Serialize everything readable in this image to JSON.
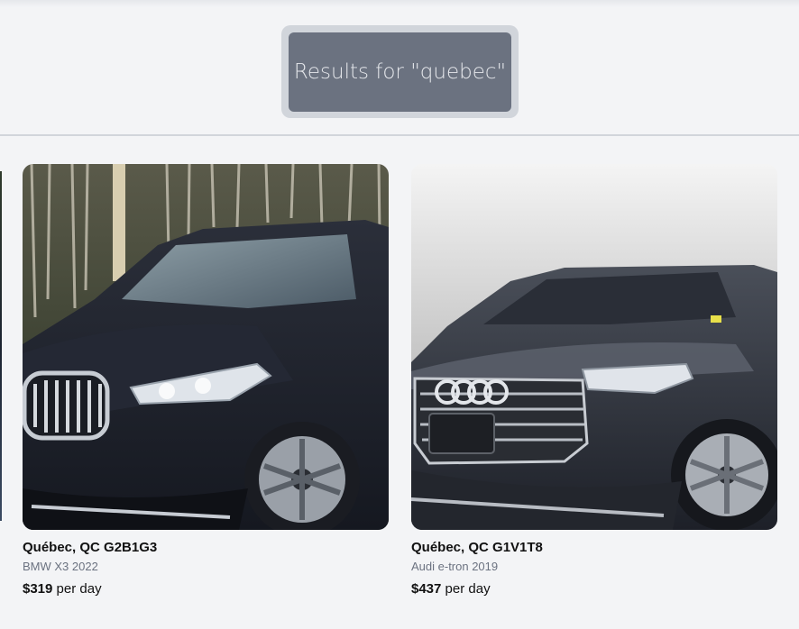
{
  "header": {
    "results_label": "Results for \"quebec\""
  },
  "listings": [
    {
      "location": "Québec, QC G2B1G3",
      "model": "BMW X3 2022",
      "price": "$319",
      "per_day": "per day",
      "photo_icon": "bmw-x3-photo"
    },
    {
      "location": "Québec, QC G1V1T8",
      "model": "Audi e-tron 2019",
      "price": "$437",
      "per_day": "per day",
      "photo_icon": "audi-etron-photo"
    }
  ],
  "colors": {
    "background": "#f3f4f6",
    "results_button": "#6b7280",
    "results_border": "#d1d5db",
    "muted_text": "#6b7280"
  }
}
